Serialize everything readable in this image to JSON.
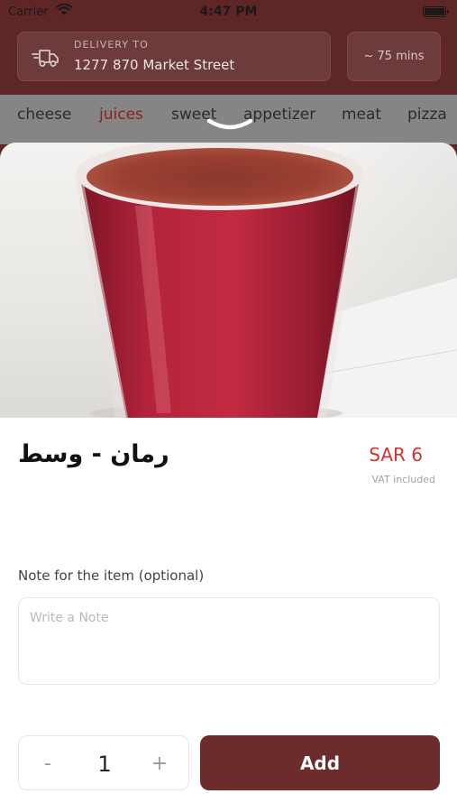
{
  "status_bar": {
    "carrier": "Carrier",
    "time": "4:47 PM"
  },
  "header": {
    "delivery_caption": "DELIVERY TO",
    "delivery_address": "1277 870 Market Street",
    "eta": "~ 75 mins",
    "delivery_icon": "truck-icon"
  },
  "categories": [
    {
      "label": "cheese",
      "active": false
    },
    {
      "label": "juices",
      "active": true
    },
    {
      "label": "sweet",
      "active": false
    },
    {
      "label": "appetizer",
      "active": false
    },
    {
      "label": "meat",
      "active": false
    },
    {
      "label": "pizza",
      "active": false
    }
  ],
  "item": {
    "name": "رمان - وسط",
    "price": "SAR 6",
    "vat_note": "VAT included",
    "photo": "pomegranate-juice-cup-photo"
  },
  "note": {
    "label": "Note for the item (optional)",
    "placeholder": "Write a Note",
    "value": ""
  },
  "order": {
    "minus_label": "-",
    "quantity": "1",
    "plus_label": "+",
    "add_label": "Add"
  },
  "colors": {
    "accent": "#6d2c2c",
    "active_category": "#8e1f1f",
    "price": "#d7322f"
  }
}
